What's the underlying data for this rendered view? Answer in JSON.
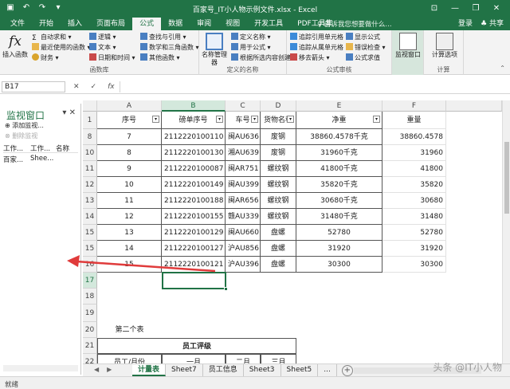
{
  "window": {
    "title": "百家号_IT小人物示例文件.xlsx - Excel",
    "controls": [
      "—",
      "❐",
      "✕"
    ]
  },
  "tabs": {
    "items": [
      "文件",
      "开始",
      "插入",
      "页面布局",
      "公式",
      "数据",
      "审阅",
      "视图",
      "开发工具",
      "PDF工具集"
    ],
    "active_index": 4,
    "tell_me": "♀ 告诉我您想要做什么...",
    "login": "登录",
    "share": "♣ 共享"
  },
  "ribbon": {
    "insert_function": "插入函数",
    "autosum": "自动求和",
    "recent": "最近使用的函数",
    "finance": "财务",
    "logical": "逻辑",
    "text": "文本",
    "datetime": "日期和时间",
    "lookup": "查找与引用",
    "math": "数学和三角函数",
    "other": "其他函数",
    "group_library": "函数库",
    "name_manager": "名称管理器",
    "define_name": "定义名称",
    "use_in_formula": "用于公式",
    "create_from_sel": "根据所选内容创建",
    "group_names": "定义的名称",
    "trace_prec": "追踪引用单元格",
    "trace_dep": "追踪从属单元格",
    "remove_arrows": "移去箭头",
    "show_formulas": "显示公式",
    "error_check": "错误检查",
    "eval_formula": "公式求值",
    "group_audit": "公式审核",
    "watch_window": "监视窗口",
    "calc_options": "计算选项",
    "group_calc": "计算"
  },
  "formula_bar": {
    "name_box": "B17",
    "cancel": "✕",
    "enter": "✓",
    "fx": "fx",
    "value": ""
  },
  "watch_pane": {
    "title": "监视窗口",
    "add": "添加监视...",
    "delete": "删除监视",
    "headers": [
      "工作...",
      "工作...",
      "名称"
    ],
    "rows": [
      [
        "百家...",
        "Shee...",
        ""
      ]
    ]
  },
  "grid": {
    "columns": [
      "A",
      "B",
      "C",
      "D",
      "E",
      "F"
    ],
    "header_row": {
      "row": "1",
      "cells": [
        "序号",
        "磅单序号",
        "车号",
        "货物名称",
        "净重",
        "重量"
      ]
    },
    "rows": [
      {
        "row": "8",
        "cells": [
          "7",
          "2112220100110",
          "闽AU636",
          "废钢",
          "38860.4578千克",
          "38860.4578"
        ]
      },
      {
        "row": "10",
        "cells": [
          "8",
          "2112220100130",
          "湘AU639",
          "废钢",
          "31960千克",
          "31960"
        ]
      },
      {
        "row": "11",
        "cells": [
          "9",
          "2112220100087",
          "闽AR751",
          "螺纹钢",
          "41800千克",
          "41800"
        ]
      },
      {
        "row": "12",
        "cells": [
          "10",
          "2112220100149",
          "闽AU399",
          "螺纹钢",
          "35820千克",
          "35820"
        ]
      },
      {
        "row": "13",
        "cells": [
          "11",
          "2112220100188",
          "闽AR656",
          "螺纹钢",
          "30680千克",
          "30680"
        ]
      },
      {
        "row": "14",
        "cells": [
          "12",
          "2112220100155",
          "赣AU339",
          "螺纹钢",
          "31480千克",
          "31480"
        ]
      },
      {
        "row": "15",
        "cells": [
          "13",
          "2112220100129",
          "闽AU660",
          "盘螺",
          "52780",
          "52780"
        ]
      },
      {
        "row": "15",
        "cells": [
          "14",
          "2112220100127",
          "沪AU856",
          "盘螺",
          "31920",
          "31920"
        ]
      },
      {
        "row": "16",
        "cells": [
          "15",
          "2112220100121",
          "沪AU396",
          "盘螺",
          "30300",
          "30300"
        ]
      }
    ],
    "empty_rows": [
      "17",
      "18",
      "19"
    ],
    "row20": {
      "row": "20",
      "label": "第二个表"
    },
    "row21": {
      "row": "21",
      "label": "员工评级"
    },
    "row22": {
      "row": "22",
      "cells": [
        "员工/月份",
        "一月",
        "二月",
        "三月"
      ]
    }
  },
  "sheets": {
    "nav": [
      "◀",
      "▶"
    ],
    "items": [
      "计量表",
      "Sheet7",
      "员工信息",
      "Sheet3",
      "Sheet5"
    ],
    "active_index": 0,
    "more": "...",
    "add": "+"
  },
  "status": {
    "text": "就绪"
  },
  "watermark": "头条 @IT小人物",
  "colors": {
    "excel_green": "#217346",
    "arrow_red": "#e03b3b"
  }
}
